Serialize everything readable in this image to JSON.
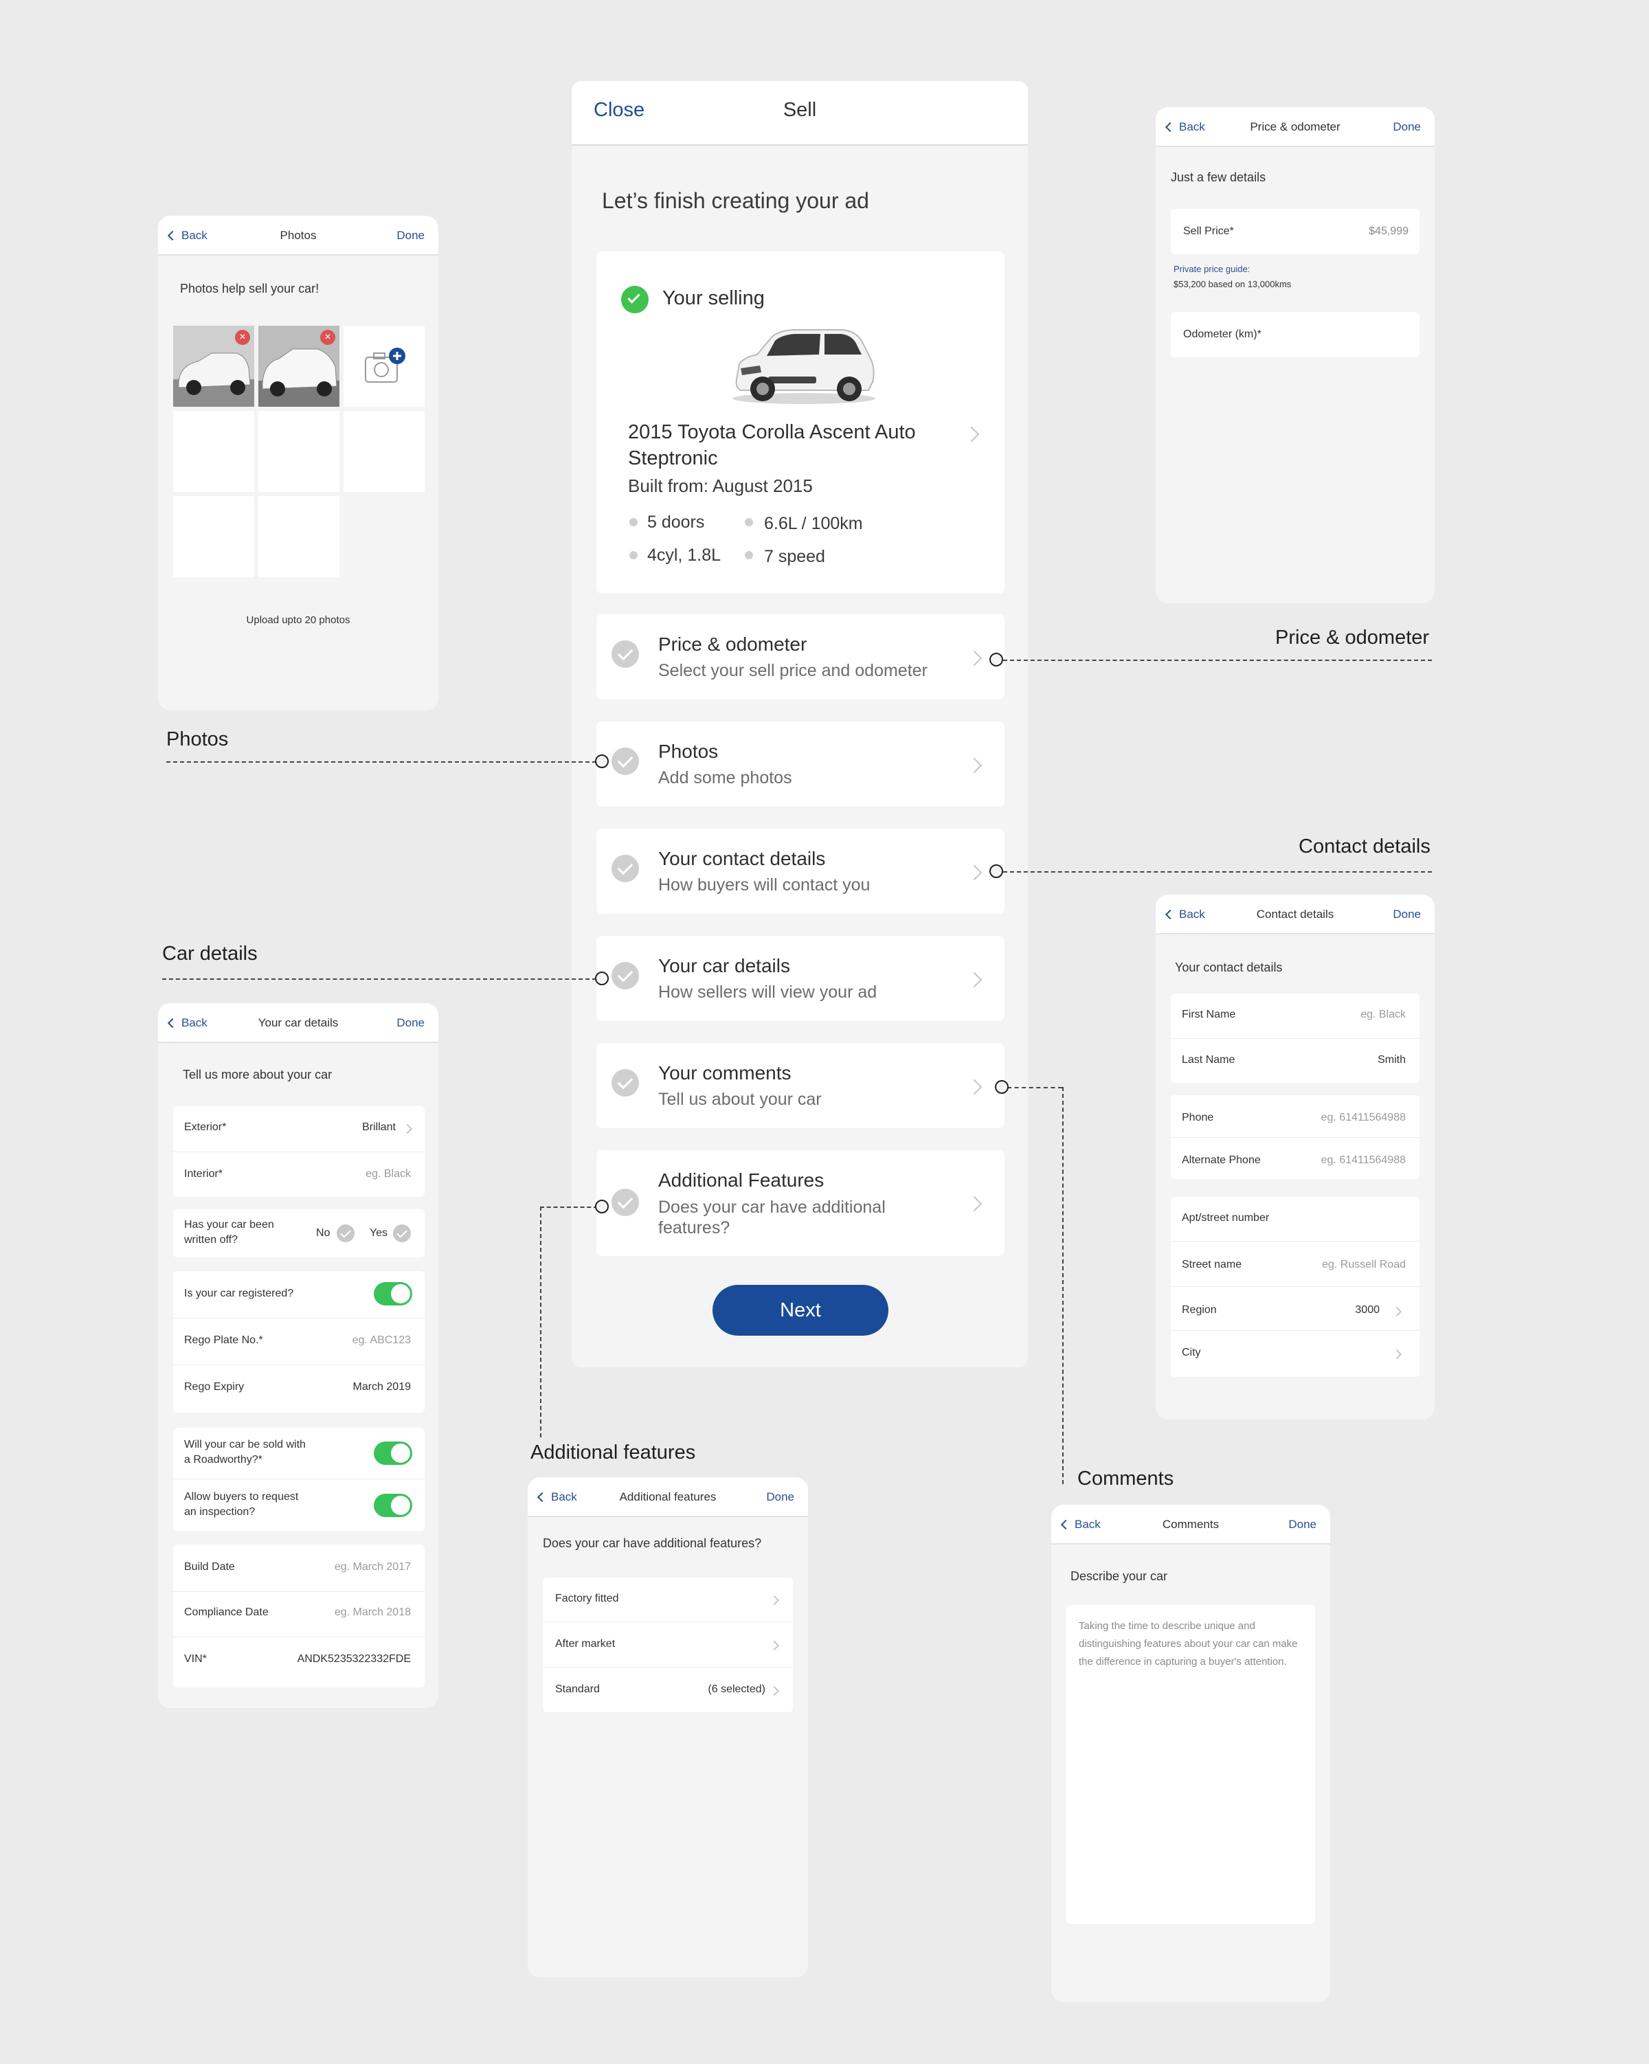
{
  "main": {
    "close_label": "Close",
    "title": "Sell",
    "heading": "Let’s finish creating your ad",
    "selling": {
      "label": "Your selling",
      "car_title": "2015 Toyota Corolla Ascent Auto Steptronic",
      "built": "Built from: August 2015",
      "specs": [
        "5 doors",
        "6.6L / 100km",
        "4cyl, 1.8L",
        "7 speed"
      ]
    },
    "steps": [
      {
        "title": "Price & odometer",
        "subtitle": "Select your sell price and odometer"
      },
      {
        "title": "Photos",
        "subtitle": "Add some photos"
      },
      {
        "title": "Your contact details",
        "subtitle": "How buyers will contact you"
      },
      {
        "title": "Your car details",
        "subtitle": "How sellers will view your ad"
      },
      {
        "title": "Your comments",
        "subtitle": "Tell us about your car"
      },
      {
        "title": "Additional Features",
        "subtitle": "Does your car have additional features?"
      }
    ],
    "next_label": "Next"
  },
  "callouts": {
    "price": "Price & odometer",
    "photos": "Photos",
    "contact": "Contact details",
    "car": "Car details",
    "additional": "Additional features",
    "comments": "Comments"
  },
  "photos_panel": {
    "back": "Back",
    "title": "Photos",
    "done": "Done",
    "heading": "Photos help sell your car!",
    "footer": "Upload upto 20 photos"
  },
  "price_panel": {
    "back": "Back",
    "title": "Price & odometer",
    "done": "Done",
    "heading": "Just a few details",
    "sell_price_label": "Sell Price*",
    "sell_price_value": "$45,999",
    "guide_label": "Private price guide:",
    "guide_value": "$53,200 based on 13,000kms",
    "odometer_label": "Odometer (km)*"
  },
  "contact_panel": {
    "back": "Back",
    "title": "Contact details",
    "done": "Done",
    "heading": "Your contact details",
    "first_name": {
      "label": "First Name",
      "value": "eg. Black"
    },
    "last_name": {
      "label": "Last Name",
      "value": "Smith"
    },
    "phone": {
      "label": "Phone",
      "value": "eg. 61411564988"
    },
    "alt_phone": {
      "label": "Alternate Phone",
      "value": "eg. 61411564988"
    },
    "apt": {
      "label": "Apt/street number"
    },
    "street": {
      "label": "Street name",
      "value": "eg. Russell Road"
    },
    "region": {
      "label": "Region",
      "value": "3000"
    },
    "city": {
      "label": "City"
    }
  },
  "car_panel": {
    "back": "Back",
    "title": "Your car details",
    "done": "Done",
    "heading": "Tell us more about your car",
    "exterior": {
      "label": "Exterior*",
      "value": "Brillant"
    },
    "interior": {
      "label": "Interior*",
      "value": "eg. Black"
    },
    "written_off": {
      "label_line1": "Has your car been",
      "label_line2": "written off?",
      "no": "No",
      "yes": "Yes"
    },
    "registered": {
      "label": "Is your car registered?",
      "on": true
    },
    "rego_plate": {
      "label": "Rego Plate No.*",
      "value": "eg. ABC123"
    },
    "rego_expiry": {
      "label": "Rego Expiry",
      "value": "March 2019"
    },
    "roadworthy": {
      "label_line1": "Will your car be sold with",
      "label_line2": "a Roadworthy?*",
      "on": true
    },
    "inspection": {
      "label_line1": "Allow buyers to request",
      "label_line2": "an inspection?",
      "on": true
    },
    "build_date": {
      "label": "Build Date",
      "value": "eg. March 2017"
    },
    "compliance_date": {
      "label": "Compliance Date",
      "value": "eg. March 2018"
    },
    "vin": {
      "label": "VIN*",
      "value": "ANDK5235322332FDE"
    }
  },
  "additional_panel": {
    "back": "Back",
    "title": "Additional features",
    "done": "Done",
    "heading": "Does your car have additional features?",
    "items": [
      {
        "label": "Factory fitted",
        "value": ""
      },
      {
        "label": "After market",
        "value": ""
      },
      {
        "label": "Standard",
        "value": "(6 selected)"
      }
    ]
  },
  "comments_panel": {
    "back": "Back",
    "title": "Comments",
    "done": "Done",
    "heading": "Describe your car",
    "placeholder": "Taking the time to describe unique and distinguishing features about your car can make the difference in capturing a buyer's attention."
  },
  "colors": {
    "brand_blue": "#1a4b99",
    "link_blue": "#2a4f91",
    "success_green": "#3fc24f",
    "toggle_green": "#39c15a",
    "remove_red": "#d9534f"
  }
}
